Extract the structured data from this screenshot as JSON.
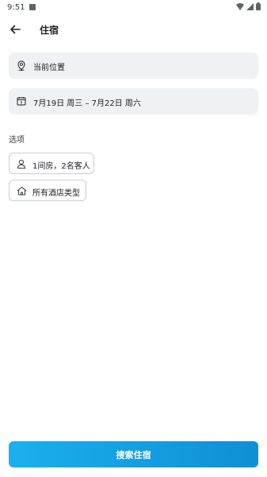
{
  "status_bar": {
    "time": "9:51",
    "notification_icon": "notification-badge-icon",
    "icons": [
      "wifi-icon",
      "signal-icon",
      "battery-icon"
    ]
  },
  "app_bar": {
    "back_icon": "arrow-back-icon",
    "title": "住宿"
  },
  "location_field": {
    "icon": "location-pin-icon",
    "value": "当前位置"
  },
  "date_field": {
    "icon": "calendar-icon",
    "value": "7月19日 周三 – 7月22日 周六"
  },
  "options": {
    "label": "选项",
    "guests_chip": {
      "icon": "person-icon",
      "label": "1间房，2名客人"
    },
    "hotel_type_chip": {
      "icon": "home-icon",
      "label": "所有酒店类型"
    }
  },
  "search_button": {
    "label": "搜索住宿"
  },
  "colors": {
    "accent_start": "#1ab0ee",
    "accent_end": "#0f8fd6",
    "field_bg": "#eff1f4"
  }
}
